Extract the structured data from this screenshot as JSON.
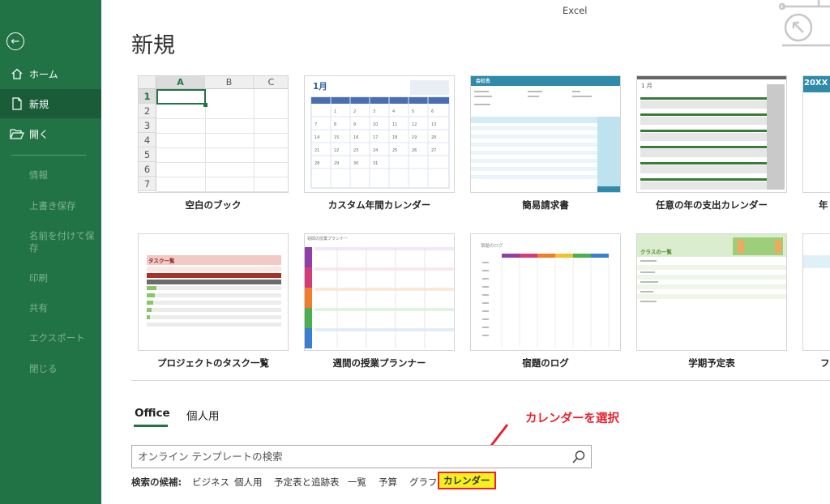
{
  "app_title": "Excel",
  "sidebar": {
    "home_label": "ホーム",
    "new_label": "新規",
    "open_label": "開く",
    "dim_items": [
      "情報",
      "上書き保存",
      "名前を付けて保存",
      "印刷",
      "共有",
      "エクスポート",
      "閉じる"
    ]
  },
  "main": {
    "title": "新規",
    "templates": [
      {
        "label": "空白のブック"
      },
      {
        "label": "カスタム年間カレンダー"
      },
      {
        "label": "簡易請求書"
      },
      {
        "label": "任意の年の支出カレンダー"
      },
      {
        "label": "年"
      },
      {
        "label": "プロジェクトのタスク一覧"
      },
      {
        "label": "週間の授業プランナー"
      },
      {
        "label": "宿題のログ"
      },
      {
        "label": "学期予定表"
      },
      {
        "label": "フ"
      }
    ],
    "blank_grid": {
      "columns": [
        "A",
        "B",
        "C"
      ],
      "rows": [
        "1",
        "2",
        "3",
        "4",
        "5",
        "6",
        "7"
      ]
    },
    "thumbs": {
      "calendar_month": "1月",
      "invoice_company": "会社名",
      "expense_month": "1 月",
      "year_partial": "20XX",
      "tasks_title": "タスク一覧",
      "planner_title": "週間の授業プランナー",
      "homework_title": "宿題のログ",
      "class_title": "クラスの一覧"
    }
  },
  "tabs": {
    "office": "Office",
    "personal": "個人用"
  },
  "annotation": "カレンダーを選択",
  "search": {
    "placeholder": "オンライン テンプレートの検索"
  },
  "suggestions": {
    "label": "検索の候補:",
    "items": [
      "ビジネス",
      "個人用",
      "予定表と追跡表",
      "一覧",
      "予算",
      "グラフ",
      "カレンダー"
    ]
  },
  "colors": {
    "sidebar_bg": "#217346",
    "accent_red": "#e8232f",
    "highlight_yellow": "#f6ef1e"
  }
}
